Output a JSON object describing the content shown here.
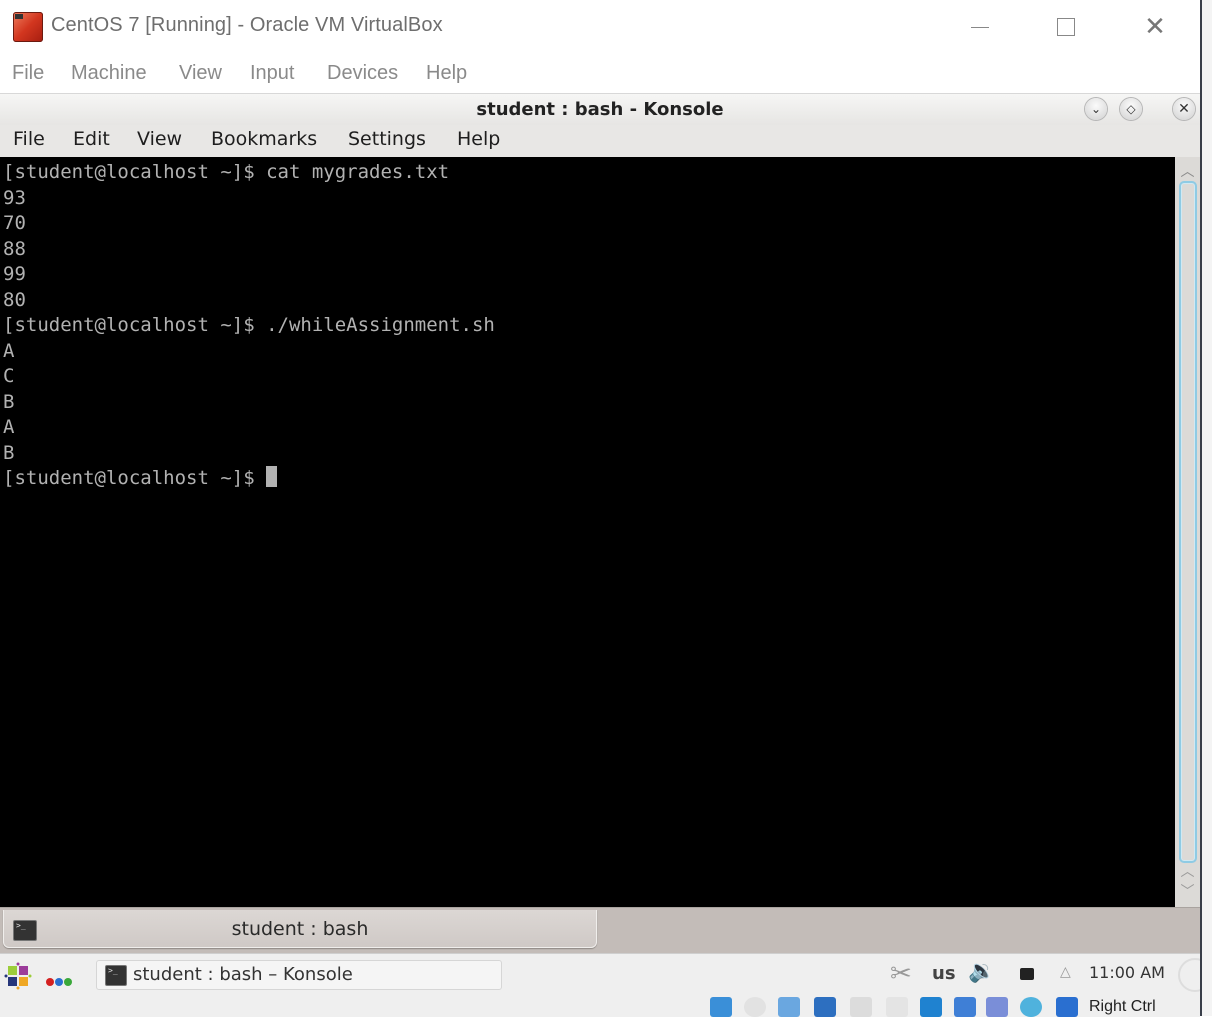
{
  "vbox": {
    "title": "CentOS 7 [Running] - Oracle VM VirtualBox",
    "menu": [
      "File",
      "Machine",
      "View",
      "Input",
      "Devices",
      "Help"
    ],
    "window_controls": {
      "minimize": "minimize-icon",
      "maximize": "maximize-icon",
      "close": "close-icon"
    },
    "status_bar": {
      "icons": [
        "hard-disk-icon",
        "optical-drive-icon",
        "audio-icon",
        "network-icon",
        "usb-icon",
        "shared-folder-icon",
        "display-icon",
        "video-capture-icon",
        "virtualization-icon",
        "mouse-integration-icon",
        "keyboard-capture-icon"
      ],
      "host_key": "Right Ctrl"
    }
  },
  "konsole": {
    "title": "student : bash - Konsole",
    "title_buttons": [
      "minimize-icon",
      "maximize-icon",
      "close-icon"
    ],
    "menu": [
      "File",
      "Edit",
      "View",
      "Bookmarks",
      "Settings",
      "Help"
    ],
    "terminal": {
      "colors": {
        "background": "#000000",
        "foreground": "#b2b2b2"
      },
      "lines": [
        "[student@localhost ~]$ cat mygrades.txt",
        "93",
        "70",
        "88",
        "99",
        "80",
        "[student@localhost ~]$ ./whileAssignment.sh",
        "A",
        "C",
        "B",
        "A",
        "B"
      ],
      "prompt": "[student@localhost ~]$ "
    },
    "tabs": [
      {
        "label": "student : bash",
        "active": true
      }
    ]
  },
  "panel": {
    "task": {
      "label": "student : bash – Konsole"
    },
    "tray": {
      "keyboard_layout": "us",
      "clock": "11:00 AM"
    },
    "dots_colors": [
      "#d42020",
      "#2a6fd0",
      "#3aa83a"
    ]
  }
}
